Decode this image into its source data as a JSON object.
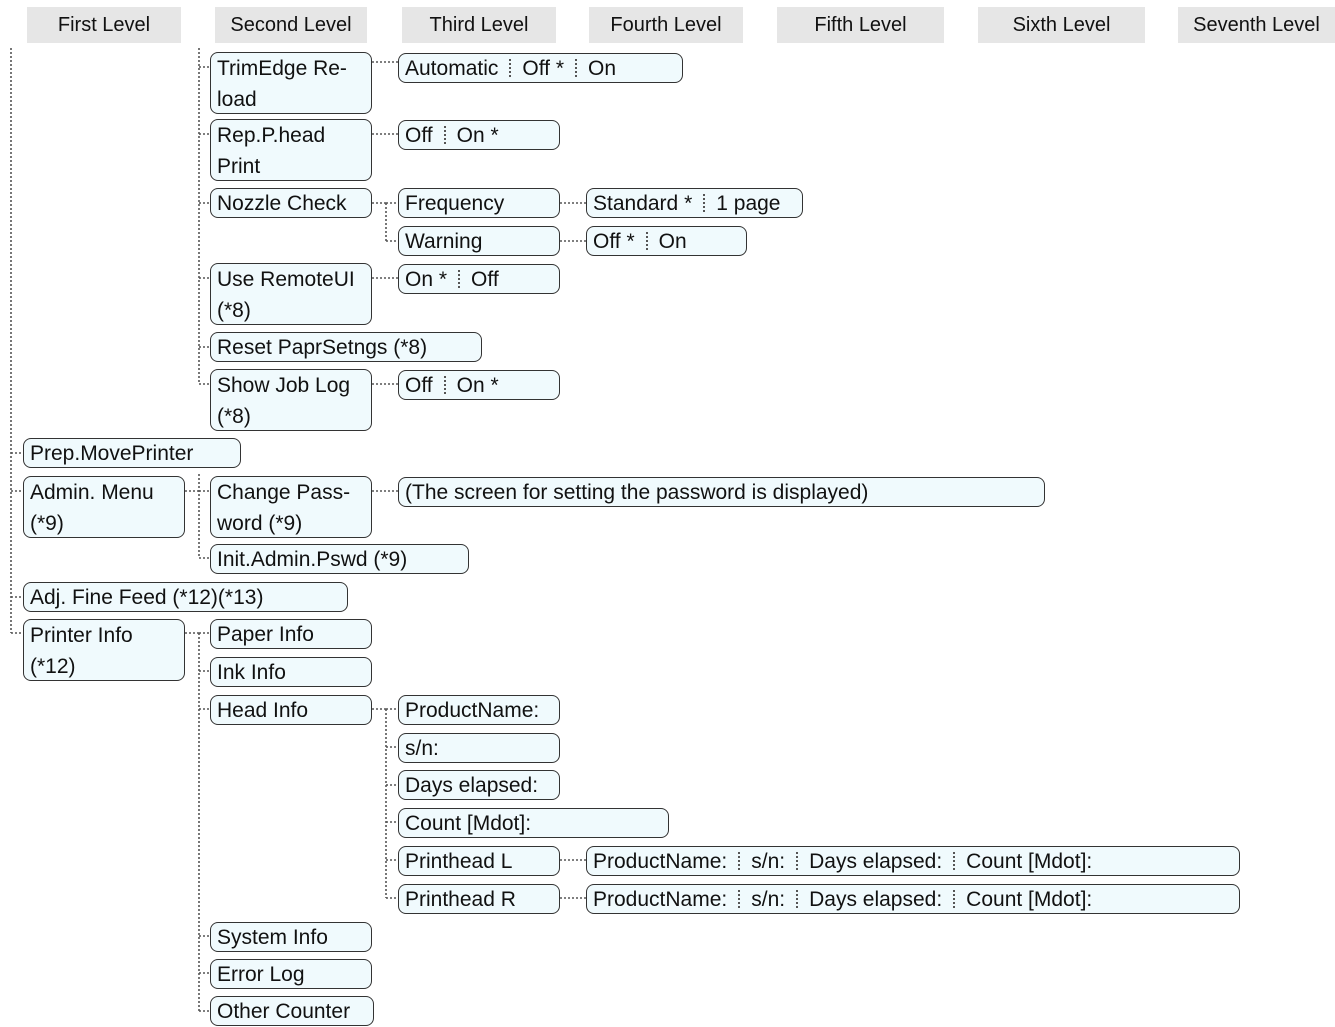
{
  "levels": [
    "First Level",
    "Second Level",
    "Third Level",
    "Fourth Level",
    "Fifth Level",
    "Sixth Level",
    "Seventh Level"
  ],
  "nodes": {
    "trimedge_reload": [
      "TrimEdge Re-",
      "load"
    ],
    "trimedge_options": [
      "Automatic",
      "Off *",
      "On"
    ],
    "rep_phead_print": [
      "Rep.P.head",
      "Print"
    ],
    "rep_phead_options": [
      "Off",
      "On *"
    ],
    "nozzle_check": "Nozzle Check",
    "frequency": "Frequency",
    "frequency_options": [
      "Standard *",
      "1 page"
    ],
    "warning": "Warning",
    "warning_options": [
      "Off *",
      "On"
    ],
    "use_remoteui": [
      "Use RemoteUI",
      "(*8)"
    ],
    "use_remoteui_options": [
      "On *",
      "Off"
    ],
    "reset_paprsetngs": "Reset PaprSetngs (*8)",
    "show_job_log": [
      "Show Job Log",
      "(*8)"
    ],
    "show_job_log_options": [
      "Off",
      "On *"
    ],
    "prep_moveprinter": "Prep.MovePrinter",
    "admin_menu": [
      "Admin. Menu",
      "(*9)"
    ],
    "change_password": [
      "Change Pass-",
      "word (*9)"
    ],
    "password_screen": "(The screen for setting the password is displayed)",
    "init_admin_pswd": "Init.Admin.Pswd (*9)",
    "adj_fine_feed": "Adj. Fine Feed (*12)(*13)",
    "printer_info": [
      "Printer Info",
      "(*12)"
    ],
    "paper_info": "Paper Info",
    "ink_info": "Ink Info",
    "head_info": "Head Info",
    "product_name": "ProductName:",
    "sn": "s/n:",
    "days_elapsed": "Days elapsed:",
    "count_mdot": "Count [Mdot]:",
    "printhead_l": "Printhead L",
    "printhead_l_options": [
      "ProductName:",
      "s/n:",
      "Days elapsed:",
      "Count [Mdot]:"
    ],
    "printhead_r": "Printhead R",
    "printhead_r_options": [
      "ProductName:",
      "s/n:",
      "Days elapsed:",
      "Count [Mdot]:"
    ],
    "system_info": "System Info",
    "error_log": "Error Log",
    "other_counter": "Other Counter"
  },
  "colors": {
    "node_fill": "#f0fafd",
    "header_fill": "#e6e6e6",
    "connector": "#555555"
  }
}
